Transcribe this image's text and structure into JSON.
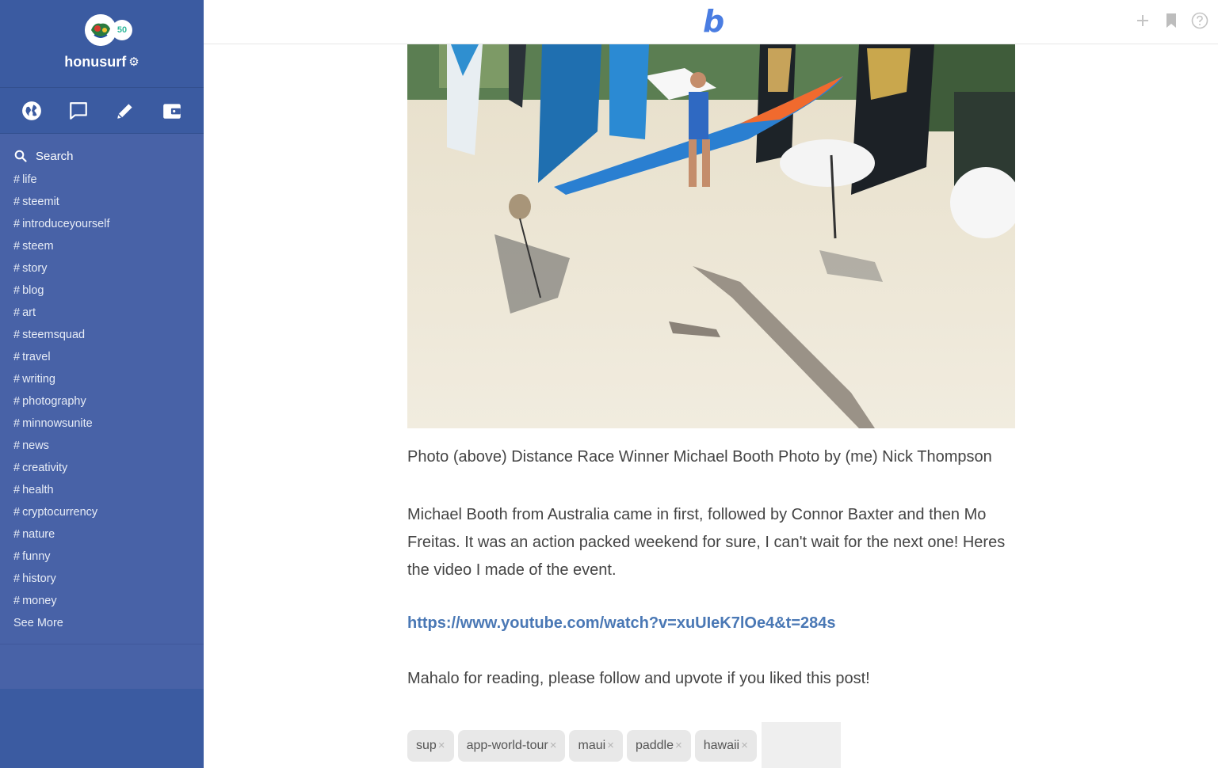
{
  "user": {
    "name": "honusurf",
    "reputation": "50"
  },
  "sidebar": {
    "nav": [
      {
        "name": "explore",
        "icon": "globe-icon"
      },
      {
        "name": "messages",
        "icon": "chat-icon"
      },
      {
        "name": "write",
        "icon": "pencil-icon"
      },
      {
        "name": "wallet",
        "icon": "wallet-icon"
      }
    ],
    "search_label": "Search",
    "tags": [
      "life",
      "steemit",
      "introduceyourself",
      "steem",
      "story",
      "blog",
      "art",
      "steemsquad",
      "travel",
      "writing",
      "photography",
      "minnowsunite",
      "news",
      "creativity",
      "health",
      "cryptocurrency",
      "nature",
      "funny",
      "history",
      "money"
    ],
    "hash": "#",
    "see_more": "See More"
  },
  "header": {
    "logo": "b",
    "actions": [
      "plus-icon",
      "bookmark-icon",
      "help-icon"
    ]
  },
  "post": {
    "caption": "Photo (above) Distance Race Winner Michael Booth Photo by (me) Nick Thompson",
    "paragraph": "Michael Booth from Australia came in first, followed by Connor Baxter and then Mo Freitas. It was an action packed weekend for sure, I can't wait for the next one! Heres the video I made of the event.",
    "link": "https://www.youtube.com/watch?v=xuUIeK7lOe4&t=284s",
    "closing": "Mahalo for reading, please follow and upvote if you liked this post!"
  },
  "post_tags": [
    "sup",
    "app-world-tour",
    "maui",
    "paddle",
    "hawaii"
  ],
  "tag_remove": "×",
  "colors": {
    "sidebar": "#3b5ba1",
    "sidebar_lower": "#4862a7",
    "logo": "#4a7de2",
    "link": "#4a78b5",
    "badge": "#2fb89a"
  }
}
